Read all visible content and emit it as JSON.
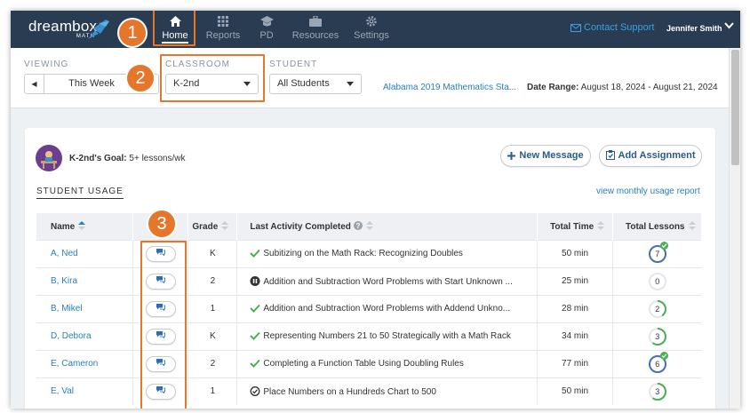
{
  "brand": {
    "name": "dreambox",
    "sub": "MATH"
  },
  "nav": {
    "items": [
      {
        "label": "Home",
        "icon": "home-icon",
        "active": true
      },
      {
        "label": "Reports",
        "icon": "grid-icon",
        "active": false
      },
      {
        "label": "PD",
        "icon": "graduation-cap-icon",
        "active": false
      },
      {
        "label": "Resources",
        "icon": "briefcase-icon",
        "active": false
      },
      {
        "label": "Settings",
        "icon": "gear-icon",
        "active": false
      }
    ],
    "contact_support": "Contact Support",
    "user_name": "Jennifer Smith"
  },
  "filters": {
    "viewing_label": "VIEWING",
    "viewing_value": "This Week",
    "classroom_label": "CLASSROOM",
    "classroom_value": "K-2nd",
    "student_label": "STUDENT",
    "student_value": "All Students",
    "standard_link": "Alabama 2019 Mathematics Sta...",
    "date_range_label": "Date Range:",
    "date_range_value": "August 18, 2024 - August 21, 2024"
  },
  "goal": {
    "label": "K-2nd's Goal:",
    "value": "5+ lessons/wk"
  },
  "actions": {
    "new_message": "New Message",
    "add_assignment": "Add Assignment"
  },
  "usage": {
    "title": "STUDENT USAGE",
    "monthly_link": "view monthly usage report",
    "columns": [
      "Name",
      "Grade",
      "Last Activity Completed",
      "Total Time",
      "Total Lessons"
    ],
    "rows": [
      {
        "name": "A, Ned",
        "grade": "K",
        "status": "check",
        "activity": "Subitizing on the Math Rack: Recognizing Doubles",
        "time": "50 min",
        "lessons": "7",
        "goal_met": true
      },
      {
        "name": "B, Kira",
        "grade": "2",
        "status": "paused",
        "activity": "Addition and Subtraction Word Problems with Start Unknown ...",
        "time": "25 min",
        "lessons": "0",
        "goal_met": false
      },
      {
        "name": "B, Mikel",
        "grade": "1",
        "status": "check",
        "activity": "Addition and Subtraction Word Problems with Addend Unkno...",
        "time": "28 min",
        "lessons": "2",
        "goal_met": false
      },
      {
        "name": "D, Debora",
        "grade": "K",
        "status": "check",
        "activity": "Representing Numbers 21 to 50 Strategically with a Math Rack",
        "time": "34 min",
        "lessons": "3",
        "goal_met": false
      },
      {
        "name": "E, Cameron",
        "grade": "2",
        "status": "check",
        "activity": "Completing a Function Table Using Doubling Rules",
        "time": "77 min",
        "lessons": "6",
        "goal_met": true
      },
      {
        "name": "E, Val",
        "grade": "1",
        "status": "circle-check",
        "activity": "Place Numbers on a Hundreds Chart to 500",
        "time": "50 min",
        "lessons": "3",
        "goal_met": false
      }
    ]
  },
  "callouts": [
    "1",
    "2",
    "3"
  ],
  "colors": {
    "nav_bg": "#2a3c52",
    "accent": "#e4772c",
    "link": "#2a7fb8",
    "success": "#4caf50"
  }
}
